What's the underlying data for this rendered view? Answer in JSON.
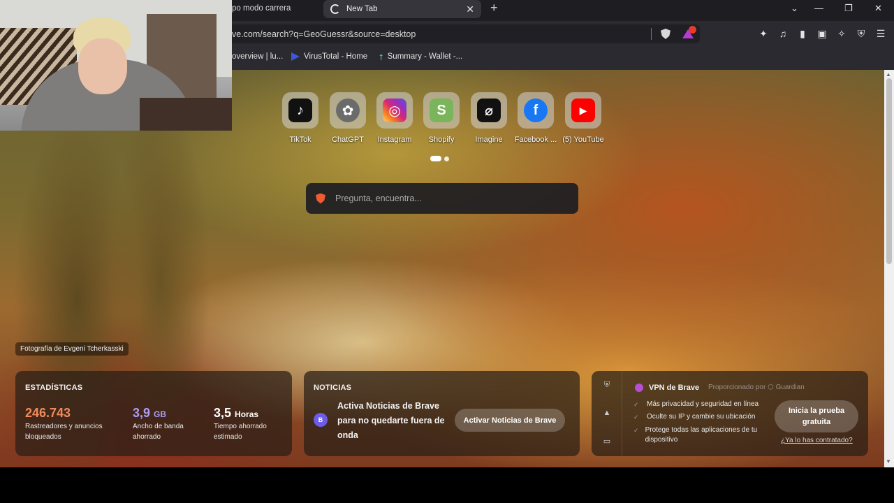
{
  "tabs": {
    "previous_title": "po modo carrera",
    "active_title": "New Tab",
    "close_symbol": "✕",
    "new_tab_symbol": "+"
  },
  "window": {
    "dropdown": "⌄",
    "minimize": "—",
    "restore": "❐",
    "close": "✕"
  },
  "address_bar": {
    "url": "ve.com/search?q=GeoGuessr&source=desktop"
  },
  "toolbar_icons": [
    "extensions-icon",
    "music-icon",
    "sidebar-icon",
    "wallet-icon",
    "leo-ai-icon",
    "vpn-icon",
    "menu-icon"
  ],
  "bookmarks": [
    {
      "label": "overview | lu...",
      "icon": "page-icon"
    },
    {
      "label": "VirusTotal - Home",
      "icon": "virustotal-icon"
    },
    {
      "label": "Summary - Wallet -...",
      "icon": "arrow-up-icon"
    }
  ],
  "top_sites": [
    {
      "label": "TikTok",
      "glyph": "♪",
      "color": "#111111"
    },
    {
      "label": "ChatGPT",
      "glyph": "✿",
      "color": "#6b6b6b"
    },
    {
      "label": "Instagram",
      "glyph": "◎",
      "color": "#d62976"
    },
    {
      "label": "Shopify",
      "glyph": "S",
      "color": "#7ab55c"
    },
    {
      "label": "Imagine",
      "glyph": "⌀",
      "color": "#111111"
    },
    {
      "label": "Facebook ...",
      "glyph": "f",
      "color": "#1877f2"
    },
    {
      "label": "(5) YouTube",
      "glyph": "▶",
      "color": "#ff0000"
    }
  ],
  "search": {
    "placeholder": "Pregunta, encuentra..."
  },
  "photo_credit": "Fotografía de Evgeni Tcherkasski",
  "stats": {
    "title": "ESTADÍSTICAS",
    "items": [
      {
        "value": "246.743",
        "unit": "",
        "desc_line1": "Rastreadores y anuncios",
        "desc_line2": "bloqueados",
        "color": "#f08a5b"
      },
      {
        "value": "3,9",
        "unit": "GB",
        "desc_line1": "Ancho de banda",
        "desc_line2": "ahorrado",
        "color": "#a99cf5"
      },
      {
        "value": "3,5",
        "unit": "Horas",
        "desc_line1": "Tiempo ahorrado",
        "desc_line2": "estimado",
        "color": "#ffffff"
      }
    ]
  },
  "news": {
    "title": "NOTICIAS",
    "badge": "B",
    "text": "Activa Noticias de Brave para no quedarte fuera de onda",
    "button": "Activar Noticias de Brave"
  },
  "vpn": {
    "title": "VPN de Brave",
    "provider": "Proporcionado por  ⬡ Guardian",
    "features": [
      "Más privacidad y seguridad en línea",
      "Oculte su IP y cambie su ubicación",
      "Protege todas las aplicaciones de tu dispositivo"
    ],
    "button": "Inicia la prueba gratuita",
    "link": "¿Ya lo has contratado?"
  }
}
